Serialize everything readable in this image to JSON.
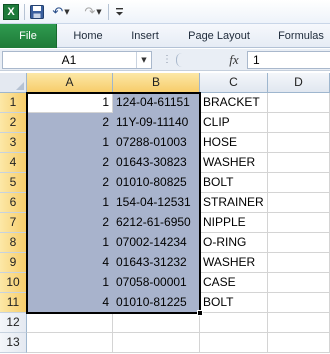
{
  "toolbar": {
    "app_icon": "excel-logo",
    "app_letter": "X",
    "save_icon": "save-icon",
    "undo_icon": "undo-icon",
    "redo_icon": "redo-icon",
    "customize_icon": "customize-qat-icon"
  },
  "ribbon": {
    "tabs": [
      "File",
      "Home",
      "Insert",
      "Page Layout",
      "Formulas"
    ],
    "file_color": "#217346"
  },
  "formula_bar": {
    "name_box": "A1",
    "fx_label": "fx",
    "content": "1"
  },
  "sheet": {
    "columns": [
      "A",
      "B",
      "C",
      "D"
    ],
    "selection_color": "#a8b3cc",
    "rows": [
      {
        "row": "1",
        "a": "1",
        "b": "124-04-61151",
        "c": "BRACKET"
      },
      {
        "row": "2",
        "a": "2",
        "b": "11Y-09-11140",
        "c": "CLIP"
      },
      {
        "row": "3",
        "a": "1",
        "b": "07288-01003",
        "c": "HOSE"
      },
      {
        "row": "4",
        "a": "2",
        "b": "01643-30823",
        "c": "WASHER"
      },
      {
        "row": "5",
        "a": "2",
        "b": "01010-80825",
        "c": "BOLT"
      },
      {
        "row": "6",
        "a": "1",
        "b": "154-04-12531",
        "c": "STRAINER"
      },
      {
        "row": "7",
        "a": "2",
        "b": "6212-61-6950",
        "c": "NIPPLE"
      },
      {
        "row": "8",
        "a": "1",
        "b": "07002-14234",
        "c": "O-RING"
      },
      {
        "row": "9",
        "a": "4",
        "b": "01643-31232",
        "c": "WASHER"
      },
      {
        "row": "10",
        "a": "1",
        "b": "07058-00001",
        "c": "CASE"
      },
      {
        "row": "11",
        "a": "4",
        "b": "01010-81225",
        "c": "BOLT"
      },
      {
        "row": "12",
        "a": "",
        "b": "",
        "c": ""
      },
      {
        "row": "13",
        "a": "",
        "b": "",
        "c": ""
      }
    ]
  }
}
